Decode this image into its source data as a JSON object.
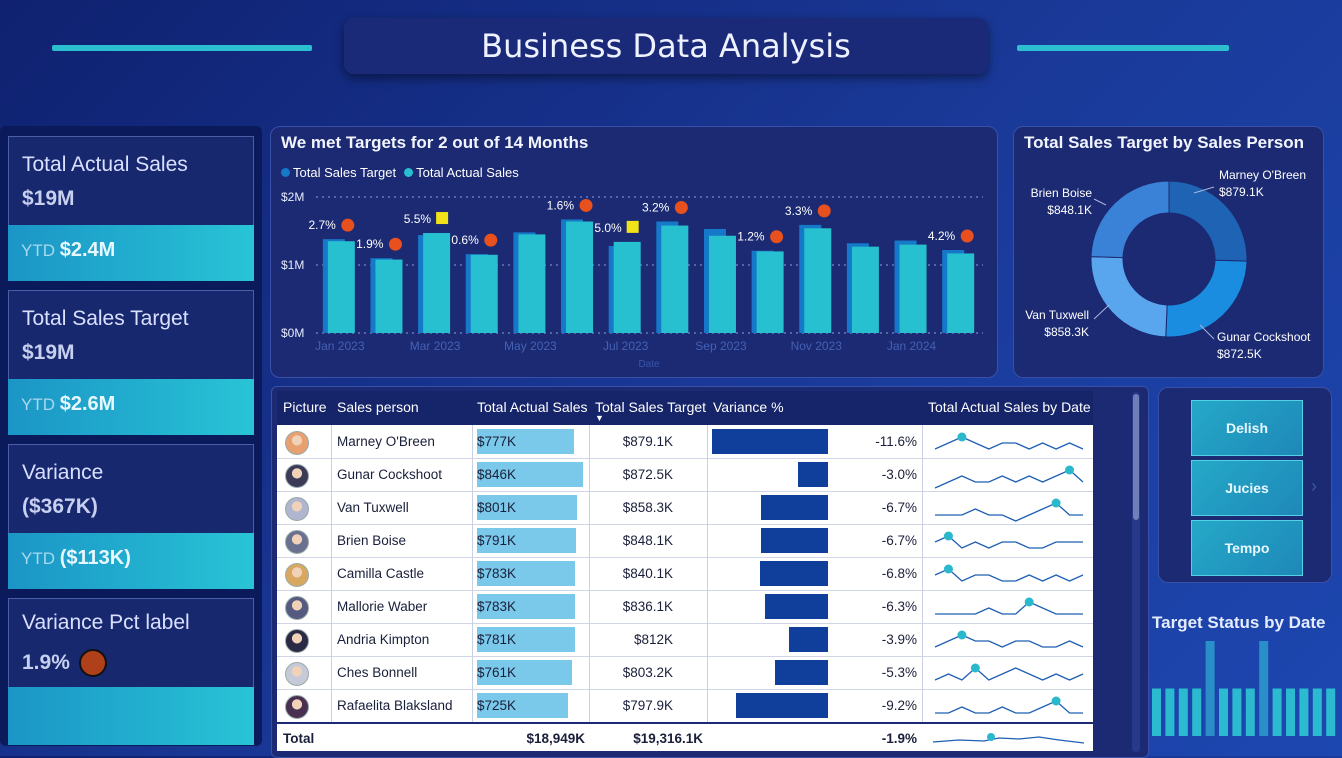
{
  "header": {
    "title": "Business Data Analysis"
  },
  "kpis": [
    {
      "label": "Total Actual Sales",
      "value": "$19M",
      "ytd_label": "YTD",
      "ytd_value": "$2.4M"
    },
    {
      "label": "Total Sales Target",
      "value": "$19M",
      "ytd_label": "YTD",
      "ytd_value": "$2.6M"
    },
    {
      "label": "Variance",
      "value": "($367K)",
      "ytd_label": "YTD",
      "ytd_value": "($113K)"
    },
    {
      "label": "Variance Pct label",
      "value": "1.9%"
    }
  ],
  "bar_chart": {
    "title": "We met Targets for 2 out of 14 Months",
    "legend": [
      "Total Sales Target",
      "Total Actual Sales"
    ],
    "y_ticks": [
      "$2M",
      "$1M",
      "$0M"
    ],
    "x_ticks": [
      "Jan 2023",
      "Mar 2023",
      "May 2023",
      "Jul 2023",
      "Sep 2023",
      "Nov 2023",
      "Jan 2024"
    ],
    "x_title": "Date"
  },
  "donut": {
    "title": "Total Sales Target by Sales Person"
  },
  "table": {
    "headers": [
      "Picture",
      "Sales person",
      "Total Actual Sales",
      "Total Sales Target",
      "Variance %",
      "Total Actual Sales by Date"
    ],
    "rows": [
      {
        "name": "Marney O'Breen",
        "actual": "$777K",
        "target": "$879.1K",
        "variance": "-11.6%"
      },
      {
        "name": "Gunar Cockshoot",
        "actual": "$846K",
        "target": "$872.5K",
        "variance": "-3.0%"
      },
      {
        "name": "Van Tuxwell",
        "actual": "$801K",
        "target": "$858.3K",
        "variance": "-6.7%"
      },
      {
        "name": "Brien Boise",
        "actual": "$791K",
        "target": "$848.1K",
        "variance": "-6.7%"
      },
      {
        "name": "Camilla Castle",
        "actual": "$783K",
        "target": "$840.1K",
        "variance": "-6.8%"
      },
      {
        "name": "Mallorie Waber",
        "actual": "$783K",
        "target": "$836.1K",
        "variance": "-6.3%"
      },
      {
        "name": "Andria Kimpton",
        "actual": "$781K",
        "target": "$812K",
        "variance": "-3.9%"
      },
      {
        "name": "Ches Bonnell",
        "actual": "$761K",
        "target": "$803.2K",
        "variance": "-5.3%"
      },
      {
        "name": "Rafaelita Blaksland",
        "actual": "$725K",
        "target": "$797.9K",
        "variance": "-9.2%"
      }
    ],
    "total": {
      "label": "Total",
      "actual": "$18,949K",
      "target": "$19,316.1K",
      "variance": "-1.9%"
    }
  },
  "slicer": {
    "items": [
      "Delish",
      "Jucies",
      "Tempo"
    ]
  },
  "target_status": {
    "title": "Target Status by Date"
  },
  "colors": {
    "target": "#1678c8",
    "actual": "#27c0d0",
    "miss": "#e8501e",
    "met": "#f2e21a"
  },
  "chart_data": [
    {
      "type": "bar",
      "title": "We met Targets for 2 out of 14 Months",
      "xlabel": "Date",
      "ylabel": "",
      "ylim": [
        0,
        2000000
      ],
      "categories": [
        "Jan 2023",
        "Feb 2023",
        "Mar 2023",
        "Apr 2023",
        "May 2023",
        "Jun 2023",
        "Jul 2023",
        "Aug 2023",
        "Sep 2023",
        "Oct 2023",
        "Nov 2023",
        "Dec 2023",
        "Jan 2024",
        "Feb 2024"
      ],
      "series": [
        {
          "name": "Total Sales Target",
          "values": [
            1380000,
            1100000,
            1440000,
            1160000,
            1480000,
            1670000,
            1280000,
            1640000,
            1530000,
            1210000,
            1590000,
            1320000,
            1360000,
            1220000
          ]
        },
        {
          "name": "Total Actual Sales",
          "values": [
            1350000,
            1080000,
            1470000,
            1150000,
            1450000,
            1640000,
            1340000,
            1580000,
            1430000,
            1200000,
            1540000,
            1270000,
            1300000,
            1170000
          ]
        }
      ],
      "annotations": [
        {
          "label": "2.7%",
          "status": "miss"
        },
        {
          "label": "1.9%",
          "status": "miss"
        },
        {
          "label": "5.5%",
          "status": "met"
        },
        {
          "label": "0.6%",
          "status": "miss"
        },
        {
          "label": "",
          "status": "none"
        },
        {
          "label": "1.6%",
          "status": "miss"
        },
        {
          "label": "5.0%",
          "status": "met"
        },
        {
          "label": "3.2%",
          "status": "miss"
        },
        {
          "label": "",
          "status": "none"
        },
        {
          "label": "1.2%",
          "status": "miss"
        },
        {
          "label": "3.3%",
          "status": "miss"
        },
        {
          "label": "",
          "status": "none"
        },
        {
          "label": "",
          "status": "none"
        },
        {
          "label": "4.2%",
          "status": "miss"
        }
      ],
      "grid": true,
      "legend": "top-left"
    },
    {
      "type": "pie",
      "title": "Total Sales Target by Sales Person",
      "slices": [
        {
          "name": "Marney O'Breen",
          "value": 879.1,
          "label": "$879.1K"
        },
        {
          "name": "Gunar Cockshoot",
          "value": 872.5,
          "label": "$872.5K"
        },
        {
          "name": "Van Tuxwell",
          "value": 858.3,
          "label": "$858.3K"
        },
        {
          "name": "Brien Boise",
          "value": 848.1,
          "label": "$848.1K"
        }
      ]
    },
    {
      "type": "bar",
      "title": "Target Status by Date",
      "values": [
        0.5,
        0.5,
        0.5,
        0.5,
        1,
        0.5,
        0.5,
        0.5,
        1,
        0.5,
        0.5,
        0.5,
        0.5,
        0.5
      ]
    }
  ],
  "sparklines": [
    [
      3,
      2,
      1,
      2,
      3,
      2,
      2,
      3,
      2,
      3,
      2,
      3
    ],
    [
      4,
      3,
      2,
      3,
      3,
      2,
      3,
      2,
      3,
      2,
      1,
      3
    ],
    [
      3,
      3,
      3,
      2,
      3,
      3,
      4,
      3,
      2,
      1,
      3,
      3
    ],
    [
      2,
      1,
      3,
      2,
      3,
      2,
      2,
      3,
      3,
      2,
      2,
      2
    ],
    [
      2,
      1,
      3,
      2,
      2,
      3,
      3,
      2,
      3,
      2,
      3,
      2
    ],
    [
      3,
      3,
      3,
      3,
      2,
      3,
      3,
      1,
      2,
      3,
      3,
      3
    ],
    [
      3,
      2,
      1,
      2,
      2,
      3,
      2,
      2,
      3,
      3,
      2,
      3
    ],
    [
      3,
      2,
      3,
      1,
      3,
      2,
      1,
      2,
      3,
      2,
      3,
      2
    ],
    [
      3,
      3,
      2,
      3,
      3,
      2,
      3,
      3,
      2,
      1,
      3,
      3
    ]
  ]
}
